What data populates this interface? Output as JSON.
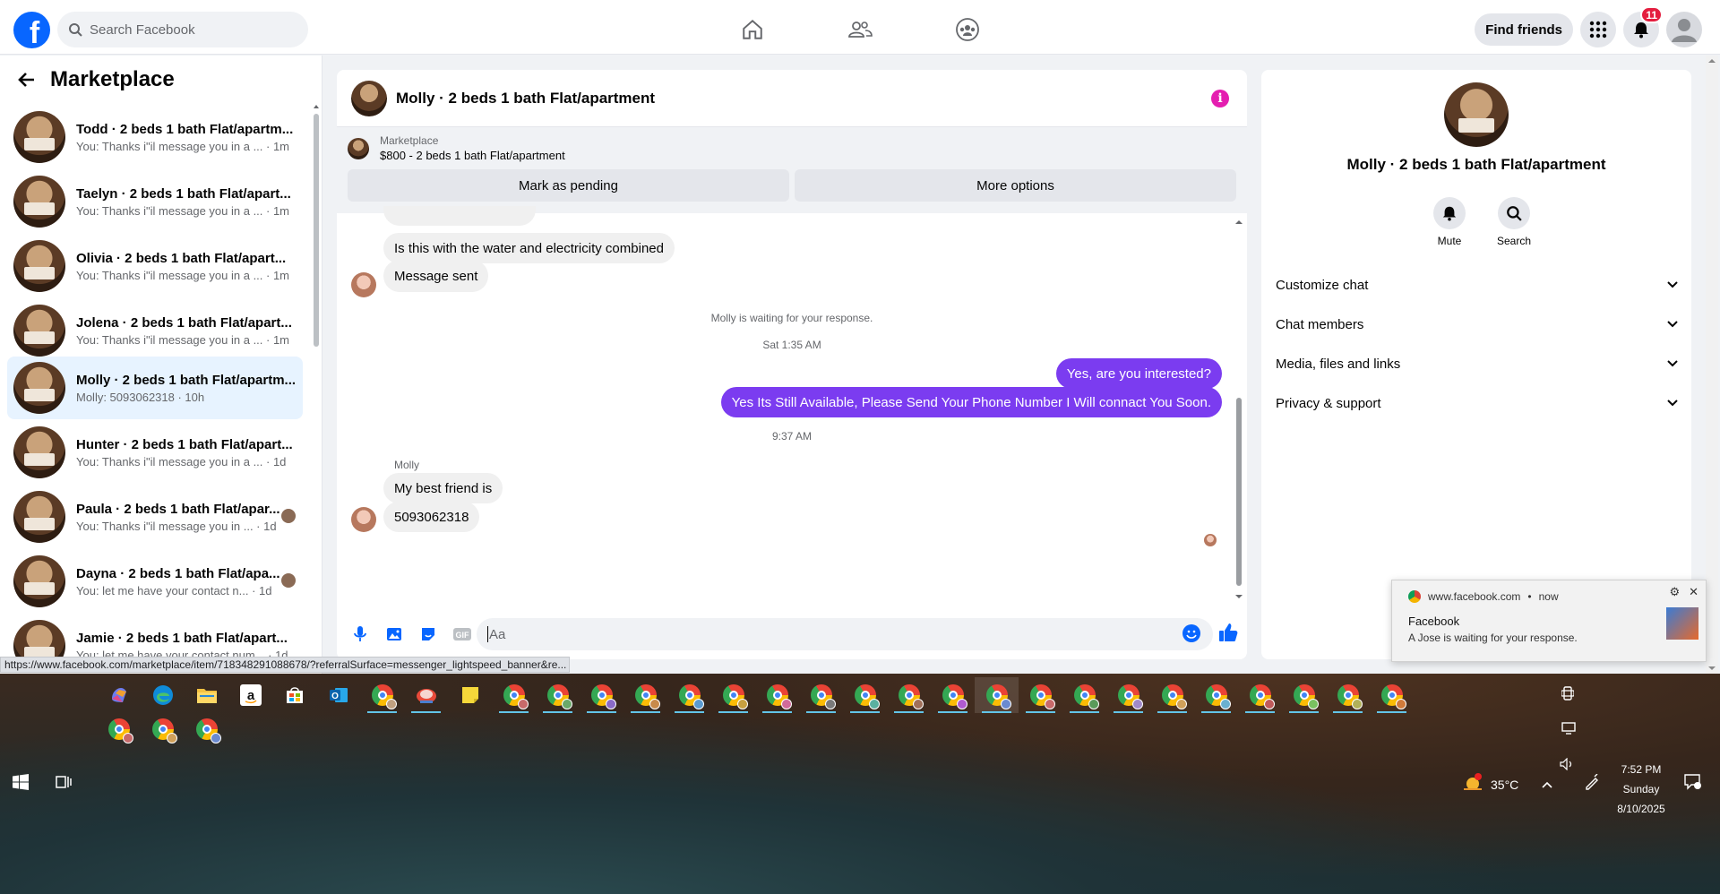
{
  "nav": {
    "logo_letter": "f",
    "search_placeholder": "Search Facebook",
    "find_friends": "Find friends",
    "notif_count": "11"
  },
  "sidebar": {
    "title": "Marketplace",
    "conversations": [
      {
        "title": "Todd · 2 beds 1 bath Flat/apartm...",
        "sub": "You: Thanks i\"il message you in a ...  · 1m"
      },
      {
        "title": "Taelyn · 2 beds 1 bath Flat/apart...",
        "sub": "You: Thanks i\"il message you in a ...  · 1m"
      },
      {
        "title": "Olivia · 2 beds 1 bath Flat/apart...",
        "sub": "You: Thanks i\"il message you in a ...  · 1m"
      },
      {
        "title": "Jolena · 2 beds 1 bath Flat/apart...",
        "sub": "You: Thanks i\"il message you in a ...  · 1m"
      },
      {
        "title": "Molly · 2 beds 1 bath Flat/apartm...",
        "sub": "Molly: 5093062318 · 10h"
      },
      {
        "title": "Hunter · 2 beds 1 bath Flat/apart...",
        "sub": "You: Thanks i\"il message you in a ...  · 1d"
      },
      {
        "title": "Paula · 2 beds 1 bath Flat/apar...",
        "sub": "You: Thanks i\"il message you in ...  · 1d"
      },
      {
        "title": "Dayna · 2 beds 1 bath Flat/apa...",
        "sub": "You: let me have your contact n...  · 1d"
      },
      {
        "title": "Jamie · 2 beds 1 bath Flat/apart...",
        "sub": "You: let me have your contact num... · 1d"
      }
    ]
  },
  "chat": {
    "title": "Molly · 2 beds 1 bath Flat/apartment",
    "marketplace_label": "Marketplace",
    "listing": "$800 - 2 beds 1 bath Flat/apartment",
    "mark_pending": "Mark as pending",
    "more_options": "More options",
    "messages": {
      "in1": "Is this with the water and electricity combined",
      "in2": "Message sent",
      "waiting": "Molly is waiting for your response.",
      "ts1": "Sat 1:35 AM",
      "out1": "Yes, are you interested?",
      "out2": "Yes Its Still Available, Please Send Your Phone Number I Will connact You Soon.",
      "ts2": "9:37 AM",
      "sender": "Molly",
      "in3": "My best friend is",
      "in4": "5093062318"
    },
    "composer_placeholder": "Aa"
  },
  "info": {
    "title": "Molly · 2 beds 1 bath Flat/apartment",
    "mute": "Mute",
    "search": "Search",
    "rows": [
      "Customize chat",
      "Chat members",
      "Media, files and links",
      "Privacy & support"
    ]
  },
  "status_url": "https://www.facebook.com/marketplace/item/718348291088678/?referralSurface=messenger_lightspeed_banner&re...",
  "toast": {
    "source": "www.facebook.com",
    "time": "now",
    "title": "Facebook",
    "body": "A Jose is waiting for your response."
  },
  "taskbar": {
    "temp": "35°C",
    "time": "7:52 PM",
    "day": "Sunday",
    "date": "8/10/2025"
  }
}
